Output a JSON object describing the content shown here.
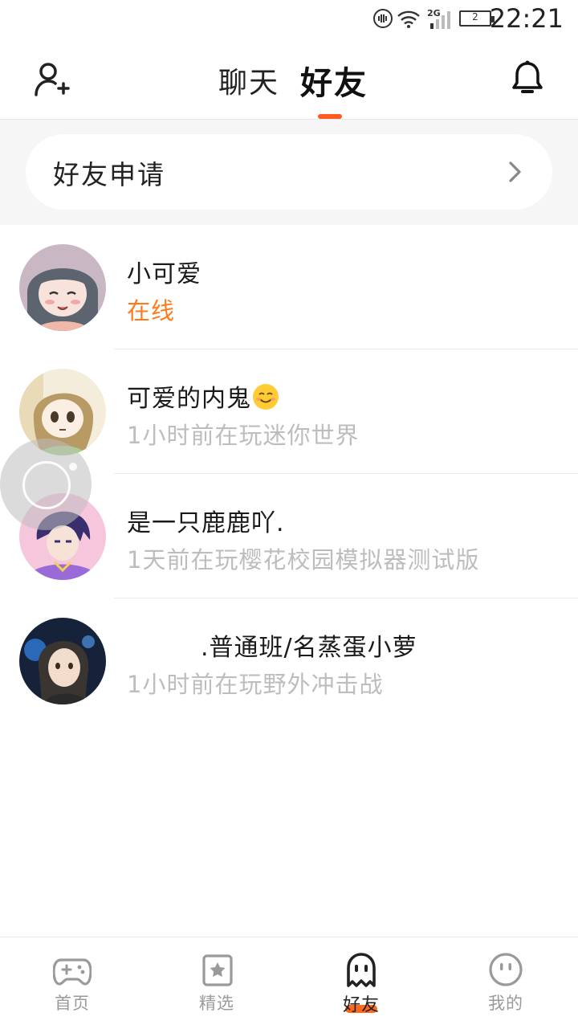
{
  "status_bar": {
    "time": "22:21",
    "network": "2G",
    "battery": "2"
  },
  "header": {
    "tabs": [
      {
        "label": "聊天",
        "active": false
      },
      {
        "label": "好友",
        "active": true
      }
    ],
    "add_friend_icon": "add-user-icon",
    "notification_icon": "bell-icon",
    "accent_color": "#ff5a1f"
  },
  "friend_request": {
    "label": "好友申请"
  },
  "friends": [
    {
      "name": "小可爱",
      "status": "在线",
      "online": true
    },
    {
      "name": "可爱的内鬼",
      "status": "1小时前在玩迷你世界",
      "online": false
    },
    {
      "name": "是一只鹿鹿吖.",
      "status": "1天前在玩樱花校园模拟器测试版",
      "online": false
    },
    {
      "name": ".普通班/名蒸蛋小萝",
      "status": "1小时前在玩野外冲击战",
      "online": false
    }
  ],
  "bottom_nav": [
    {
      "label": "首页",
      "icon": "gamepad-icon"
    },
    {
      "label": "精选",
      "icon": "star-bookmark-icon"
    },
    {
      "label": "好友",
      "icon": "ghost-icon",
      "active": true
    },
    {
      "label": "我的",
      "icon": "face-icon"
    }
  ]
}
